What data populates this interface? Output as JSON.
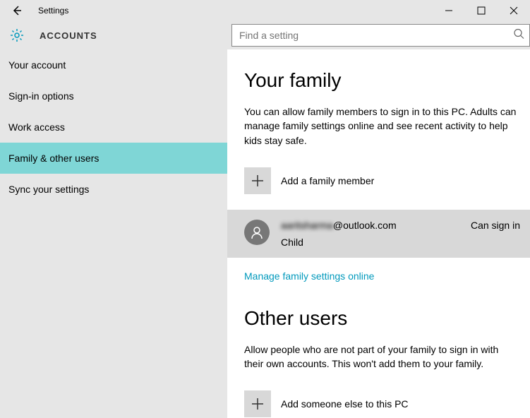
{
  "titlebar": {
    "title": "Settings"
  },
  "header": {
    "section": "ACCOUNTS",
    "search_placeholder": "Find a setting"
  },
  "sidebar": {
    "items": [
      {
        "label": "Your account"
      },
      {
        "label": "Sign-in options"
      },
      {
        "label": "Work access"
      },
      {
        "label": "Family & other users"
      },
      {
        "label": "Sync your settings"
      }
    ]
  },
  "content": {
    "family_heading": "Your family",
    "family_desc": "You can allow family members to sign in to this PC. Adults can manage family settings online and see recent activity to help kids stay safe.",
    "add_family_label": "Add a family member",
    "member": {
      "email_blurred": "aaritsharma",
      "email_suffix": "@outlook.com",
      "role": "Child",
      "status": "Can sign in"
    },
    "manage_link": "Manage family settings online",
    "other_heading": "Other users",
    "other_desc": "Allow people who are not part of your family to sign in with their own accounts. This won't add them to your family.",
    "add_other_label": "Add someone else to this PC"
  }
}
